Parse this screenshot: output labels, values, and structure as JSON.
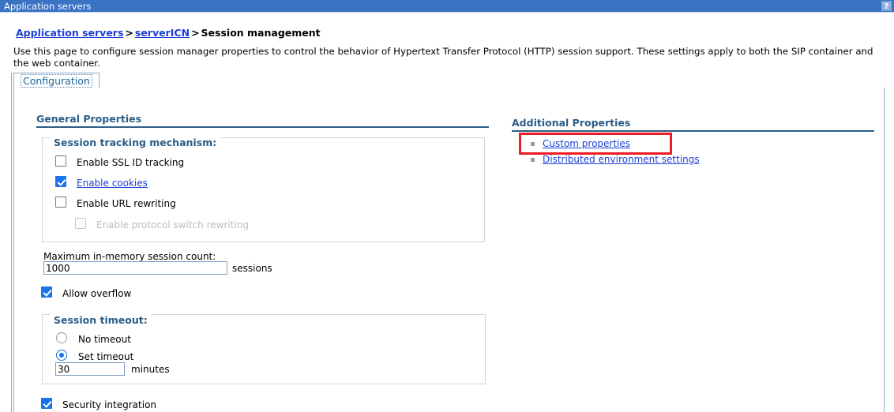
{
  "window": {
    "title": "Application servers",
    "help_icon": "?",
    "titlebar_color": "#3a72c4"
  },
  "breadcrumb": {
    "items": [
      {
        "label": "Application servers",
        "link": true
      },
      {
        "label": "serverICN",
        "link": true
      },
      {
        "label": "Session management",
        "link": false
      }
    ],
    "separator": ">"
  },
  "page": {
    "description": "Use this page to configure session manager properties to control the behavior of Hypertext Transfer Protocol (HTTP) session support. These settings apply to both the SIP container and the web container."
  },
  "tabs": [
    {
      "label": "Configuration",
      "selected": true
    }
  ],
  "general_properties": {
    "heading": "General Properties",
    "session_tracking": {
      "legend": "Session tracking mechanism:",
      "options": [
        {
          "label": "Enable SSL ID tracking",
          "checked": false,
          "disabled": false,
          "link": false
        },
        {
          "label": "Enable cookies",
          "checked": true,
          "disabled": false,
          "link": true
        },
        {
          "label": "Enable URL rewriting",
          "checked": false,
          "disabled": false,
          "link": false
        },
        {
          "label": "Enable protocol switch rewriting",
          "checked": false,
          "disabled": true,
          "link": false
        }
      ]
    },
    "max_sessions": {
      "label": "Maximum in-memory session count:",
      "value": "1000",
      "unit": "sessions"
    },
    "allow_overflow": {
      "label": "Allow overflow",
      "checked": true
    },
    "session_timeout": {
      "legend": "Session timeout:",
      "options": [
        {
          "label": "No timeout",
          "selected": false
        },
        {
          "label": "Set timeout",
          "selected": true
        }
      ],
      "timeout_value": "30",
      "timeout_unit": "minutes"
    },
    "security_integration": {
      "label": "Security integration",
      "checked": true
    }
  },
  "additional_properties": {
    "heading": "Additional Properties",
    "links": [
      {
        "label": "Custom properties",
        "highlighted": true
      },
      {
        "label": "Distributed environment settings",
        "highlighted": false
      }
    ],
    "highlight_color": "#ee1c25"
  }
}
